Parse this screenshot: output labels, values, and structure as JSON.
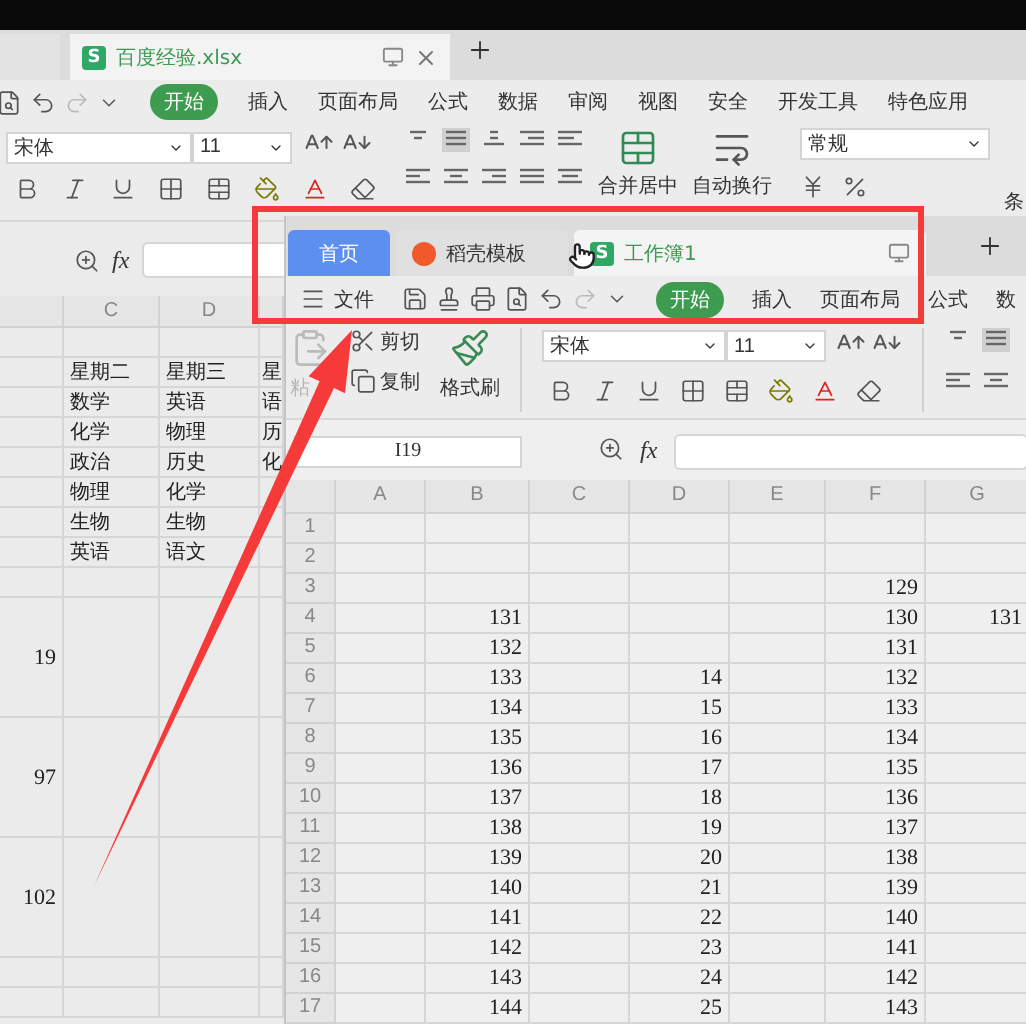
{
  "back_window": {
    "tabs": [
      {
        "selected": false
      },
      {
        "label": "百度经验.xlsx",
        "icon_text": "S",
        "selected": true
      }
    ],
    "menu": [
      {
        "label": "开始",
        "selected": true
      },
      {
        "label": "插入",
        "selected": false
      },
      {
        "label": "页面布局",
        "selected": false
      },
      {
        "label": "公式",
        "selected": false
      },
      {
        "label": "数据",
        "selected": false
      },
      {
        "label": "审阅",
        "selected": false
      },
      {
        "label": "视图",
        "selected": false
      },
      {
        "label": "安全",
        "selected": false
      },
      {
        "label": "开发工具",
        "selected": false
      },
      {
        "label": "特色应用",
        "selected": false
      }
    ],
    "ribbon": {
      "font": "宋体",
      "size": "11",
      "merge": "合并居中",
      "wrap": "自动换行",
      "number_format": "常规",
      "conditional": "条"
    },
    "formula_label": "fx",
    "sheet": {
      "columns": [
        null,
        "C",
        "D",
        null
      ],
      "rows": [
        {
          "kind": "normal",
          "cells": [
            null,
            null,
            null,
            null
          ]
        },
        {
          "kind": "normal",
          "cells": [
            null,
            "星期二",
            "星期三",
            "星"
          ]
        },
        {
          "kind": "normal",
          "cells": [
            null,
            "数学",
            "英语",
            "语"
          ]
        },
        {
          "kind": "normal",
          "cells": [
            null,
            "化学",
            "物理",
            "历"
          ]
        },
        {
          "kind": "normal",
          "cells": [
            null,
            "政治",
            "历史",
            "化"
          ]
        },
        {
          "kind": "normal",
          "cells": [
            null,
            "物理",
            "化学",
            null
          ]
        },
        {
          "kind": "normal",
          "cells": [
            null,
            "生物",
            "生物",
            null
          ]
        },
        {
          "kind": "normal",
          "cells": [
            null,
            "英语",
            "语文",
            null
          ]
        },
        {
          "kind": "normal",
          "cells": [
            null,
            null,
            null,
            null
          ]
        },
        {
          "kind": "tall",
          "cells": [
            "19",
            null,
            null,
            null
          ]
        },
        {
          "kind": "tall",
          "cells": [
            "97",
            null,
            null,
            null
          ]
        },
        {
          "kind": "tall",
          "cells": [
            "102",
            null,
            null,
            null
          ]
        },
        {
          "kind": "normal",
          "cells": [
            null,
            null,
            null,
            null
          ]
        },
        {
          "kind": "normal",
          "cells": [
            null,
            null,
            null,
            null
          ]
        }
      ]
    }
  },
  "front_window": {
    "tabs": [
      {
        "kind": "home",
        "label": "首页",
        "selected": false
      },
      {
        "kind": "template",
        "label": "稻壳模板",
        "selected": false
      },
      {
        "kind": "workbook",
        "label": "工作簿1",
        "icon_text": "S",
        "selected": true
      }
    ],
    "file_menu": "文件",
    "menu": [
      {
        "label": "开始",
        "selected": true
      },
      {
        "label": "插入",
        "selected": false
      },
      {
        "label": "页面布局",
        "selected": false
      },
      {
        "label": "公式",
        "selected": false
      },
      {
        "label": "数",
        "selected": false
      }
    ],
    "ribbon": {
      "paste": {
        "label": "粘",
        "disabled": true
      },
      "cut": "剪切",
      "copy": "复制",
      "format_painter": "格式刷",
      "font": "宋体",
      "size": "11"
    },
    "name_box": "I19",
    "formula_label": "fx",
    "sheet": {
      "columns": [
        "A",
        "B",
        "C",
        "D",
        "E",
        "F",
        "G"
      ],
      "rows": [
        {
          "header": "1",
          "cells": [
            null,
            null,
            null,
            null,
            null,
            null,
            null
          ]
        },
        {
          "header": "2",
          "cells": [
            null,
            null,
            null,
            null,
            null,
            null,
            null
          ]
        },
        {
          "header": "3",
          "cells": [
            null,
            null,
            null,
            null,
            null,
            "129",
            null
          ]
        },
        {
          "header": "4",
          "cells": [
            null,
            "131",
            null,
            null,
            null,
            "130",
            "131"
          ]
        },
        {
          "header": "5",
          "cells": [
            null,
            "132",
            null,
            null,
            null,
            "131",
            null
          ]
        },
        {
          "header": "6",
          "cells": [
            null,
            "133",
            null,
            "14",
            null,
            "132",
            null
          ]
        },
        {
          "header": "7",
          "cells": [
            null,
            "134",
            null,
            "15",
            null,
            "133",
            null
          ]
        },
        {
          "header": "8",
          "cells": [
            null,
            "135",
            null,
            "16",
            null,
            "134",
            null
          ]
        },
        {
          "header": "9",
          "cells": [
            null,
            "136",
            null,
            "17",
            null,
            "135",
            null
          ]
        },
        {
          "header": "10",
          "cells": [
            null,
            "137",
            null,
            "18",
            null,
            "136",
            null
          ]
        },
        {
          "header": "11",
          "cells": [
            null,
            "138",
            null,
            "19",
            null,
            "137",
            null
          ]
        },
        {
          "header": "12",
          "cells": [
            null,
            "139",
            null,
            "20",
            null,
            "138",
            null
          ]
        },
        {
          "header": "13",
          "cells": [
            null,
            "140",
            null,
            "21",
            null,
            "139",
            null
          ]
        },
        {
          "header": "14",
          "cells": [
            null,
            "141",
            null,
            "22",
            null,
            "140",
            null
          ]
        },
        {
          "header": "15",
          "cells": [
            null,
            "142",
            null,
            "23",
            null,
            "141",
            null
          ]
        },
        {
          "header": "16",
          "cells": [
            null,
            "143",
            null,
            "24",
            null,
            "142",
            null
          ]
        },
        {
          "header": "17",
          "cells": [
            null,
            "144",
            null,
            "25",
            null,
            "143",
            null
          ]
        }
      ]
    }
  },
  "annotation": {
    "highlight": true,
    "arrow": true
  }
}
